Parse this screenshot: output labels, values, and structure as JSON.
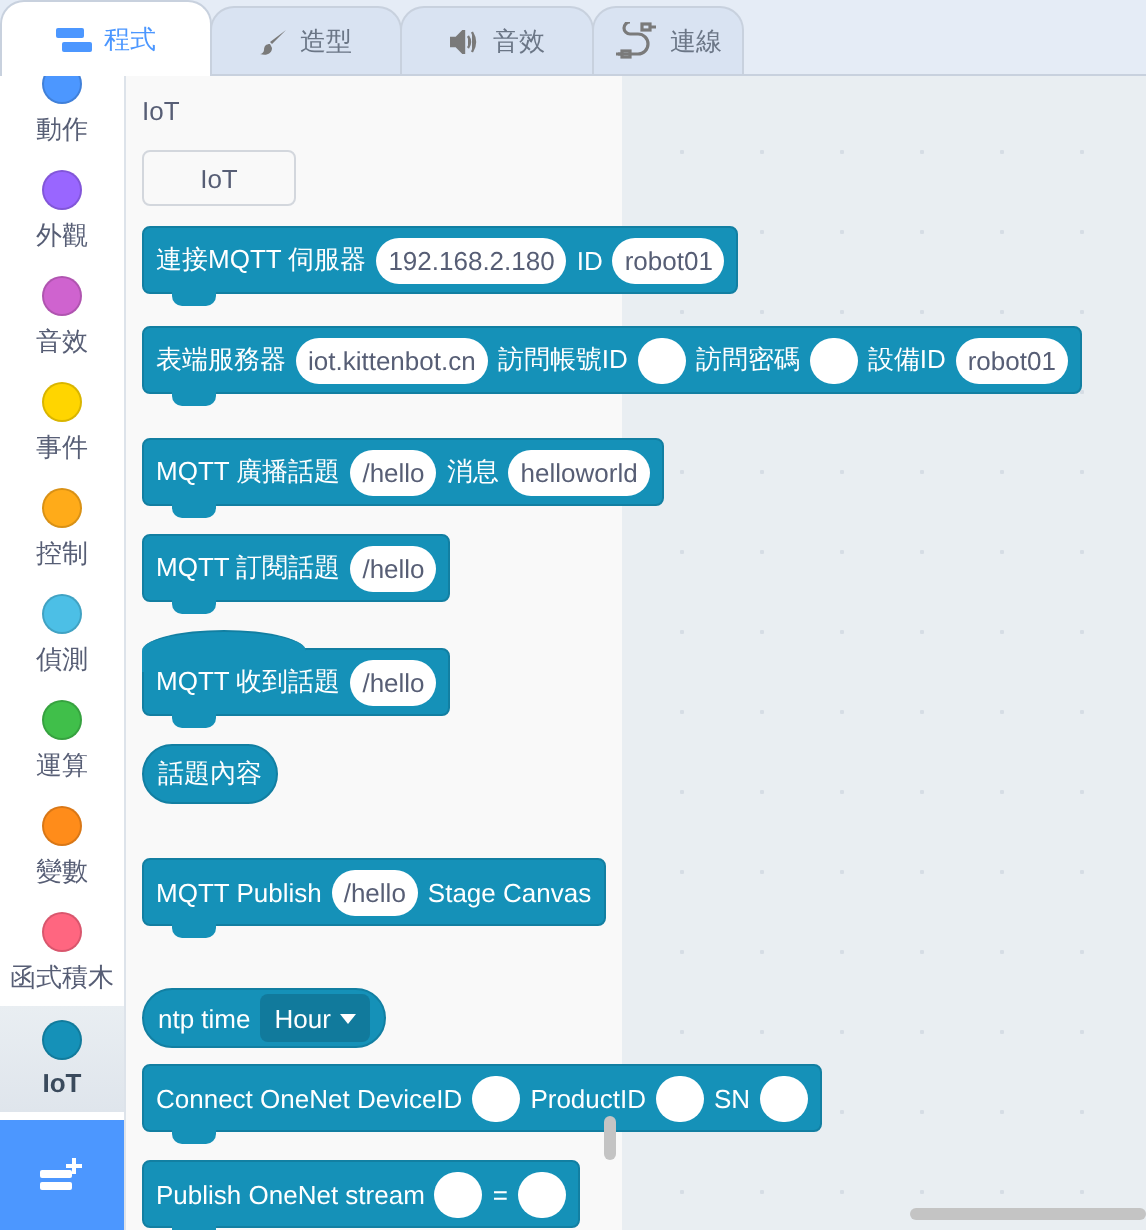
{
  "tabs": [
    {
      "label": "程式",
      "selected": true
    },
    {
      "label": "造型",
      "selected": false
    },
    {
      "label": "音效",
      "selected": false
    },
    {
      "label": "連線",
      "selected": false
    }
  ],
  "categories": [
    {
      "label": "動作",
      "color": "#4c97ff",
      "selected": false
    },
    {
      "label": "外觀",
      "color": "#9966ff",
      "selected": false
    },
    {
      "label": "音效",
      "color": "#cf63cf",
      "selected": false
    },
    {
      "label": "事件",
      "color": "#ffd500",
      "selected": false
    },
    {
      "label": "控制",
      "color": "#ffab19",
      "selected": false
    },
    {
      "label": "偵測",
      "color": "#4cbfe6",
      "selected": false
    },
    {
      "label": "運算",
      "color": "#40bf4a",
      "selected": false
    },
    {
      "label": "變數",
      "color": "#ff8c1a",
      "selected": false
    },
    {
      "label": "函式積木",
      "color": "#ff6680",
      "selected": false
    },
    {
      "label": "IoT",
      "color": "#1591b8",
      "selected": true
    }
  ],
  "flyout": {
    "title": "IoT",
    "button": "IoT",
    "blocks": [
      {
        "kind": "command",
        "parts": [
          {
            "kind": "text",
            "text": "連接MQTT 伺服器"
          },
          {
            "kind": "input",
            "value": "192.168.2.180"
          },
          {
            "kind": "text",
            "text": "ID"
          },
          {
            "kind": "input",
            "value": "robot01"
          }
        ]
      },
      {
        "kind": "command",
        "parts": [
          {
            "kind": "text",
            "text": "表端服務器"
          },
          {
            "kind": "input",
            "value": "iot.kittenbot.cn"
          },
          {
            "kind": "text",
            "text": "訪問帳號ID"
          },
          {
            "kind": "input"
          },
          {
            "kind": "text",
            "text": "訪問密碼"
          },
          {
            "kind": "input"
          },
          {
            "kind": "text",
            "text": "設備ID"
          },
          {
            "kind": "input",
            "value": "robot01"
          }
        ]
      },
      {
        "kind": "command",
        "parts": [
          {
            "kind": "text",
            "text": "MQTT 廣播話題"
          },
          {
            "kind": "input",
            "value": "/hello"
          },
          {
            "kind": "text",
            "text": "消息"
          },
          {
            "kind": "input",
            "value": "helloworld"
          }
        ]
      },
      {
        "kind": "command",
        "parts": [
          {
            "kind": "text",
            "text": "MQTT 訂閱話題"
          },
          {
            "kind": "input",
            "value": "/hello"
          }
        ]
      },
      {
        "kind": "hat",
        "parts": [
          {
            "kind": "text",
            "text": "MQTT 收到話題"
          },
          {
            "kind": "input",
            "value": "/hello"
          }
        ]
      },
      {
        "kind": "reporter",
        "parts": [
          {
            "kind": "text",
            "text": "話題內容"
          }
        ]
      },
      {
        "kind": "command",
        "parts": [
          {
            "kind": "text",
            "text": "MQTT Publish"
          },
          {
            "kind": "input",
            "value": "/hello"
          },
          {
            "kind": "text",
            "text": "Stage Canvas"
          }
        ]
      },
      {
        "kind": "reporter",
        "parts": [
          {
            "kind": "text",
            "text": "ntp time"
          },
          {
            "kind": "dropdown",
            "value": "Hour"
          }
        ]
      },
      {
        "kind": "command",
        "parts": [
          {
            "kind": "text",
            "text": "Connect OneNet DeviceID"
          },
          {
            "kind": "input"
          },
          {
            "kind": "text",
            "text": "ProductID"
          },
          {
            "kind": "input"
          },
          {
            "kind": "text",
            "text": "SN"
          },
          {
            "kind": "input"
          }
        ]
      },
      {
        "kind": "command",
        "parts": [
          {
            "kind": "text",
            "text": "Publish OneNet stream"
          },
          {
            "kind": "input"
          },
          {
            "kind": "text",
            "text": "="
          },
          {
            "kind": "input"
          }
        ]
      }
    ]
  }
}
